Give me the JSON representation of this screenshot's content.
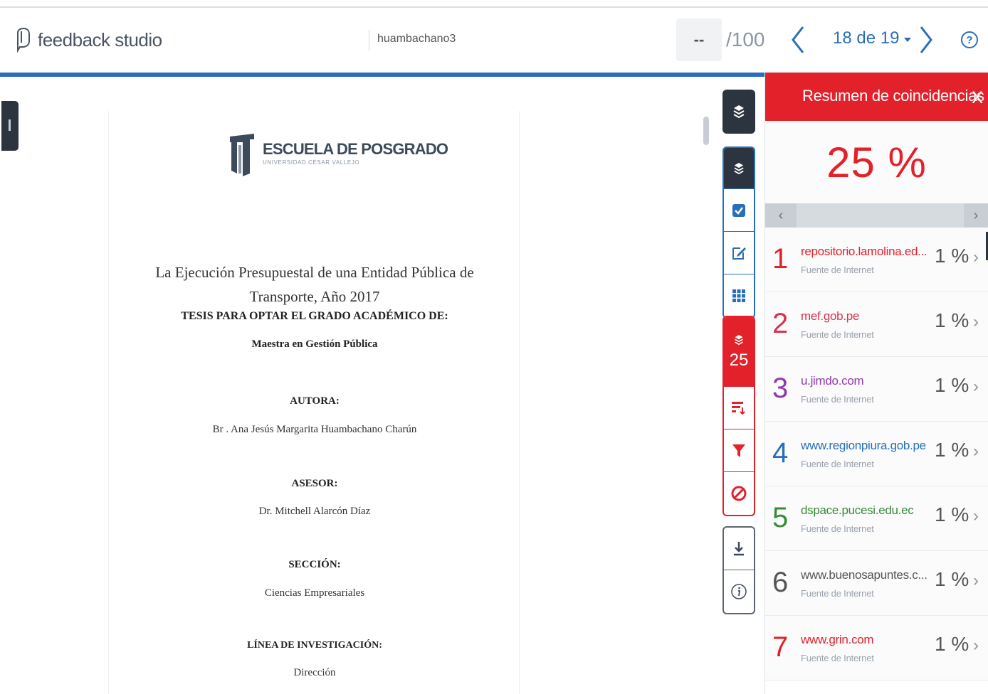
{
  "app": {
    "name": "feedback studio",
    "assignment_user": "huambachano3"
  },
  "grade": {
    "value": "--",
    "max": "/100"
  },
  "pager": {
    "label": "18 de 19"
  },
  "help": {
    "label": "?"
  },
  "document": {
    "school_name": "ESCUELA DE POSGRADO",
    "school_sub": "UNIVERSIDAD CÉSAR VALLEJO",
    "title_line1": "La Ejecución Presupuestal de una Entidad Pública de",
    "title_line2": "Transporte, Año 2017",
    "thesis_heading": "TESIS PARA OPTAR EL GRADO ACADÉMICO DE:",
    "degree": "Maestra en Gestión Pública",
    "author_heading": "AUTORA:",
    "author": "Br . Ana Jesús Margarita Huambachano Charún",
    "advisor_heading": "ASESOR:",
    "advisor": "Dr. Mitchell Alarcón Díaz",
    "section_heading": "SECCIÓN:",
    "section": "Ciencias Empresariales",
    "research_heading": "LÍNEA DE INVESTIGACIÓN:",
    "research": "Dirección"
  },
  "toolbar": {
    "similarity_score": "25"
  },
  "panel": {
    "title": "Resumen de coincidencias",
    "close": "X",
    "overall_score": "25 %",
    "matches": [
      {
        "num": "1",
        "source": "repositorio.lamolina.ed...",
        "type": "Fuente de Internet",
        "pct": "1 %",
        "color": "#e2212a"
      },
      {
        "num": "2",
        "source": "mef.gob.pe",
        "type": "Fuente de Internet",
        "pct": "1 %",
        "color": "#d6334f"
      },
      {
        "num": "3",
        "source": "u.jimdo.com",
        "type": "Fuente de Internet",
        "pct": "1 %",
        "color": "#8e3aa8"
      },
      {
        "num": "4",
        "source": "www.regionpiura.gob.pe",
        "type": "Fuente de Internet",
        "pct": "1 %",
        "color": "#2a6ebb"
      },
      {
        "num": "5",
        "source": "dspace.pucesi.edu.ec",
        "type": "Fuente de Internet",
        "pct": "1 %",
        "color": "#3a8a3a"
      },
      {
        "num": "6",
        "source": "www.buenosapuntes.c...",
        "type": "Fuente de Internet",
        "pct": "1 %",
        "color": "#555555"
      },
      {
        "num": "7",
        "source": "www.grin.com",
        "type": "Fuente de Internet",
        "pct": "1 %",
        "color": "#e2212a"
      }
    ]
  },
  "colors": {
    "brand_blue": "#2a6ebb",
    "similarity_red": "#e2212a",
    "dark": "#2c3440"
  },
  "icons": [
    "feedback-studio-logo-icon",
    "chevron-left-icon",
    "chevron-right-icon",
    "help-icon",
    "layers-icon",
    "checkbox-icon",
    "edit-icon",
    "grid-icon",
    "match-breakdown-icon",
    "filter-icon",
    "exclude-icon",
    "download-icon",
    "info-icon",
    "close-icon"
  ]
}
